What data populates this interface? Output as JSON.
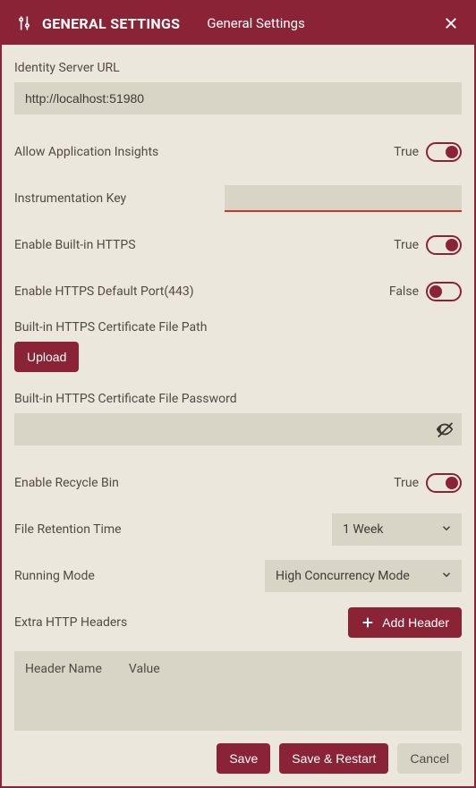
{
  "header": {
    "title": "GENERAL SETTINGS",
    "subtitle": "General Settings"
  },
  "identity": {
    "label": "Identity Server URL",
    "value": "http://localhost:51980"
  },
  "insights": {
    "label": "Allow Application Insights",
    "value_label": "True",
    "on": true
  },
  "instr": {
    "label": "Instrumentation Key",
    "value": ""
  },
  "https": {
    "label": "Enable Built-in HTTPS",
    "value_label": "True",
    "on": true
  },
  "https_port": {
    "label": "Enable HTTPS Default Port(443)",
    "value_label": "False",
    "on": false
  },
  "cert_path": {
    "label": "Built-in HTTPS Certificate File Path",
    "button": "Upload"
  },
  "cert_pw": {
    "label": "Built-in HTTPS Certificate File Password",
    "value": ""
  },
  "recycle": {
    "label": "Enable Recycle Bin",
    "value_label": "True",
    "on": true
  },
  "retention": {
    "label": "File Retention Time",
    "selected": "1 Week"
  },
  "mode": {
    "label": "Running Mode",
    "selected": "High Concurrency Mode"
  },
  "headers": {
    "label": "Extra HTTP Headers",
    "add_button": "Add Header",
    "col_name": "Header Name",
    "col_value": "Value",
    "rows": []
  },
  "footer": {
    "save": "Save",
    "save_restart": "Save & Restart",
    "cancel": "Cancel"
  }
}
